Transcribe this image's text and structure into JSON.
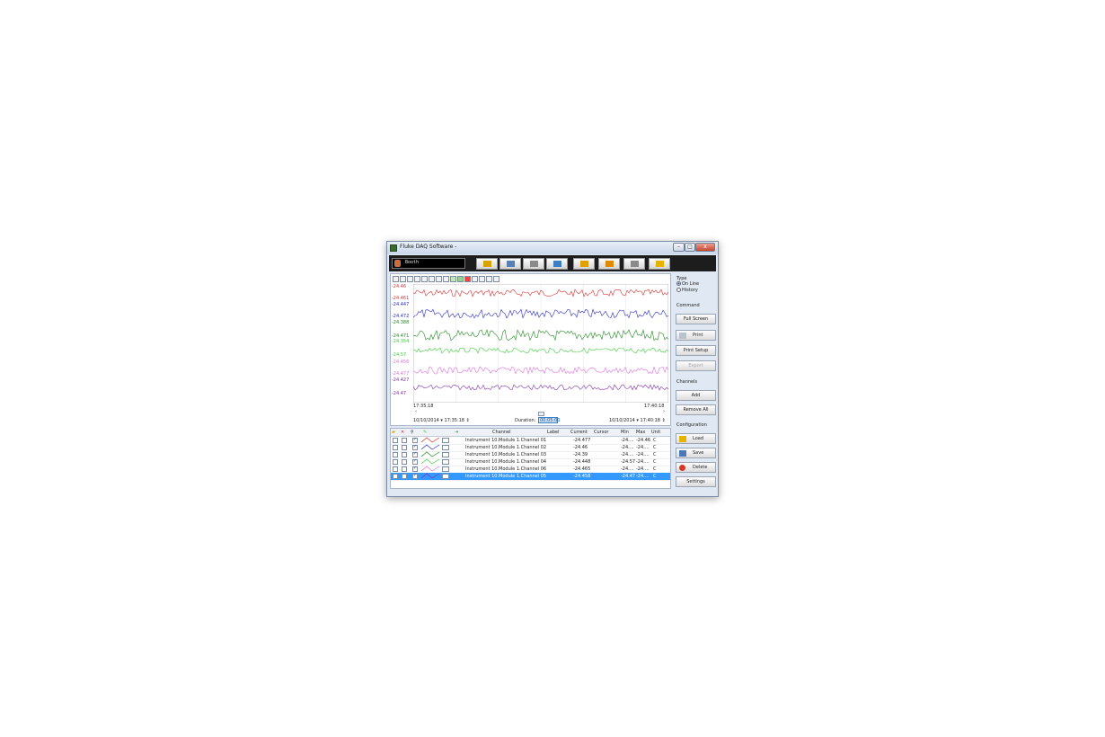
{
  "window": {
    "title": "Fluke DAQ Software -",
    "minimize": "–",
    "maximize": "□",
    "close": "x"
  },
  "topbar": {
    "user_name": "Booth",
    "buttons": [
      {
        "icon": "lock-icon",
        "color": "#d9a300"
      },
      {
        "icon": "user-icon",
        "color": "#5a7fb3"
      },
      {
        "icon": "list-icon",
        "color": "#8a8a8a"
      },
      {
        "icon": "monitors-icon",
        "color": "#3e7fc4"
      },
      {
        "icon": "chart-icon",
        "color": "#e1a100"
      },
      {
        "icon": "alarm-icon",
        "color": "#e08a00"
      },
      {
        "icon": "email-icon",
        "color": "#8a8a8a"
      },
      {
        "icon": "star-icon",
        "color": "#e6b300"
      }
    ]
  },
  "chart": {
    "y_labels": [
      {
        "text": "-24.46",
        "color": "#e03030"
      },
      {
        "text": "-24.461",
        "color": "#e03030"
      },
      {
        "text": "-24.447",
        "color": "#2a2ad0"
      },
      {
        "text": "-24.472",
        "color": "#2a2ad0"
      },
      {
        "text": "-24.388",
        "color": "#1f8a1f"
      },
      {
        "text": "-24.471",
        "color": "#1f8a1f"
      },
      {
        "text": "-24.354",
        "color": "#3ccf3c"
      },
      {
        "text": "-24.57",
        "color": "#3ccf3c"
      },
      {
        "text": "-24.456",
        "color": "#e070e0"
      },
      {
        "text": "-24.477",
        "color": "#e070e0"
      },
      {
        "text": "-24.427",
        "color": "#8030b0"
      },
      {
        "text": "-24.47",
        "color": "#8030b0"
      }
    ],
    "series_colors": [
      "#e03030",
      "#2a2ad0",
      "#1f8a1f",
      "#3ccf3c",
      "#e070e0",
      "#8030b0"
    ],
    "time_start": "17:35:18",
    "time_end": "17:40:18",
    "start_date": "10/10/2014",
    "start_time": "17:35:18",
    "duration_label": "Duration:",
    "duration_value": "00:05:00",
    "end_date": "10/10/2014",
    "end_time": "17:40:18"
  },
  "grid": {
    "headers": {
      "channel": "Channel",
      "label": "Label",
      "current": "Current",
      "cursor": "Cursor",
      "min": "Min",
      "max": "Max",
      "unit": "Unit"
    },
    "rows": [
      {
        "channel": "Instrument 10.Module 1.Channel 01",
        "label": "",
        "current": "-24.477",
        "cursor": "",
        "min": "-24....",
        "max": "-24.46",
        "unit": "C",
        "color": "#e03030"
      },
      {
        "channel": "Instrument 10.Module 1.Channel 02",
        "label": "",
        "current": "-24.46",
        "cursor": "",
        "min": "-24....",
        "max": "-24....",
        "unit": "C",
        "color": "#2a2ad0"
      },
      {
        "channel": "Instrument 10.Module 1.Channel 03",
        "label": "",
        "current": "-24.39",
        "cursor": "",
        "min": "-24....",
        "max": "-24....",
        "unit": "C",
        "color": "#1f8a1f"
      },
      {
        "channel": "Instrument 10.Module 1.Channel 04",
        "label": "",
        "current": "-24.448",
        "cursor": "",
        "min": "-24.57",
        "max": "-24....",
        "unit": "C",
        "color": "#3ccf3c"
      },
      {
        "channel": "Instrument 10.Module 1.Channel 06",
        "label": "",
        "current": "-24.465",
        "cursor": "",
        "min": "-24....",
        "max": "-24....",
        "unit": "C",
        "color": "#e070e0"
      },
      {
        "channel": "Instrument 10.Module 1.Channel 05",
        "label": "",
        "current": "-24.458",
        "cursor": "",
        "min": "-24.47",
        "max": "-24....",
        "unit": "C",
        "color": "#8030b0"
      }
    ]
  },
  "side": {
    "type_label": "Type",
    "online_label": "On Line",
    "history_label": "History",
    "command_label": "Command",
    "full_screen": "Full Screen",
    "print": "Print",
    "print_setup": "Print Setup",
    "export": "Export",
    "channels_label": "Channels",
    "add": "Add",
    "remove_all": "Remove All",
    "configuration_label": "Configuration",
    "load": "Load",
    "save": "Save",
    "delete": "Delete",
    "settings": "Settings"
  }
}
